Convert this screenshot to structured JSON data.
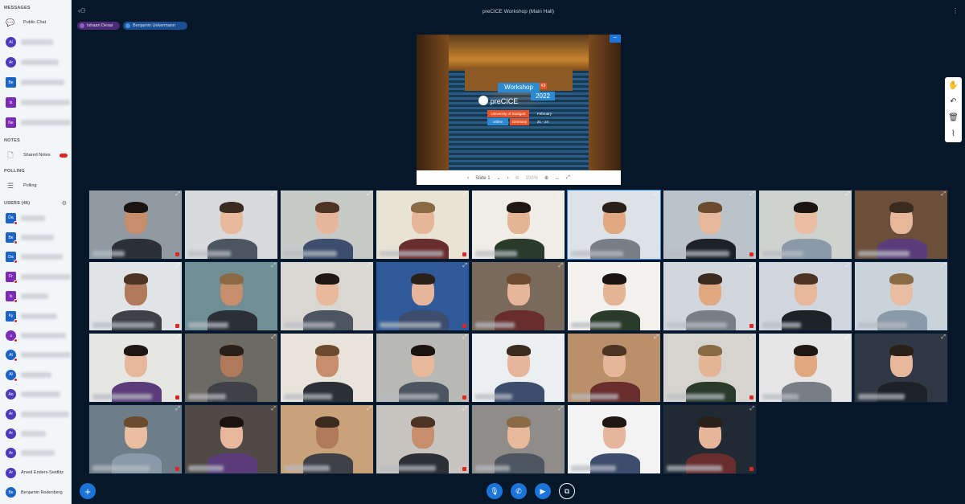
{
  "window_title": "preCICE Workshop (Main Hall)",
  "sidebar": {
    "messages_title": "MESSAGES",
    "public_chat_label": "Public Chat",
    "chats": [
      {
        "initials": "Al",
        "color": "#4a3bbd"
      },
      {
        "initials": "Ar",
        "color": "#4a3bbd"
      },
      {
        "initials": "Be",
        "color": "#1b63c4"
      },
      {
        "initials": "Is",
        "color": "#7a2cb5"
      },
      {
        "initials": "Ne",
        "color": "#7a2cb5"
      }
    ],
    "notes_title": "NOTES",
    "shared_notes_label": "Shared Notes",
    "polling_title": "POLLING",
    "polling_label": "Polling",
    "users_title": "USERS (46)",
    "users": [
      {
        "initials": "Da",
        "color": "#1b63c4",
        "name": ""
      },
      {
        "initials": "Be",
        "color": "#1b63c4",
        "name": ""
      },
      {
        "initials": "Da",
        "color": "#1b63c4",
        "name": ""
      },
      {
        "initials": "Fr",
        "color": "#7a2cb5",
        "name": ""
      },
      {
        "initials": "Is",
        "color": "#7a2cb5",
        "name": ""
      },
      {
        "initials": "Ky",
        "color": "#1b63c4",
        "name": ""
      },
      {
        "initials": "☺",
        "color": "#7a2cb5",
        "name": ""
      },
      {
        "initials": "Al",
        "color": "#1b63c4",
        "name": ""
      },
      {
        "initials": "Al",
        "color": "#1b63c4",
        "name": ""
      },
      {
        "initials": "An",
        "color": "#4a3bbd",
        "name": ""
      },
      {
        "initials": "Ar",
        "color": "#4a3bbd",
        "name": ""
      },
      {
        "initials": "Ar",
        "color": "#4a3bbd",
        "name": ""
      },
      {
        "initials": "Ar",
        "color": "#4a3bbd",
        "name": ""
      },
      {
        "initials": "Ar",
        "color": "#4a3bbd",
        "name": "Arved Enders-Seidlitz"
      },
      {
        "initials": "Be",
        "color": "#1b63c4",
        "name": "Benjamin Rodenberg"
      }
    ]
  },
  "talkers": [
    {
      "name": "Ishaan Desai",
      "color": "#4d2a7a"
    },
    {
      "name": "Benjamin Uekermann",
      "color": "#1b4f94"
    }
  ],
  "presentation": {
    "workshop": "Workshop",
    "edition": "#3",
    "year": "2022",
    "logo_text": "preCICE",
    "tags": [
      "University of Stuttgart",
      "February",
      "online",
      "Germany",
      "21 - 24"
    ],
    "slide_label": "Slide 1",
    "zoom": "100%"
  },
  "accent": "#1b74d8",
  "tiles_count": 34
}
